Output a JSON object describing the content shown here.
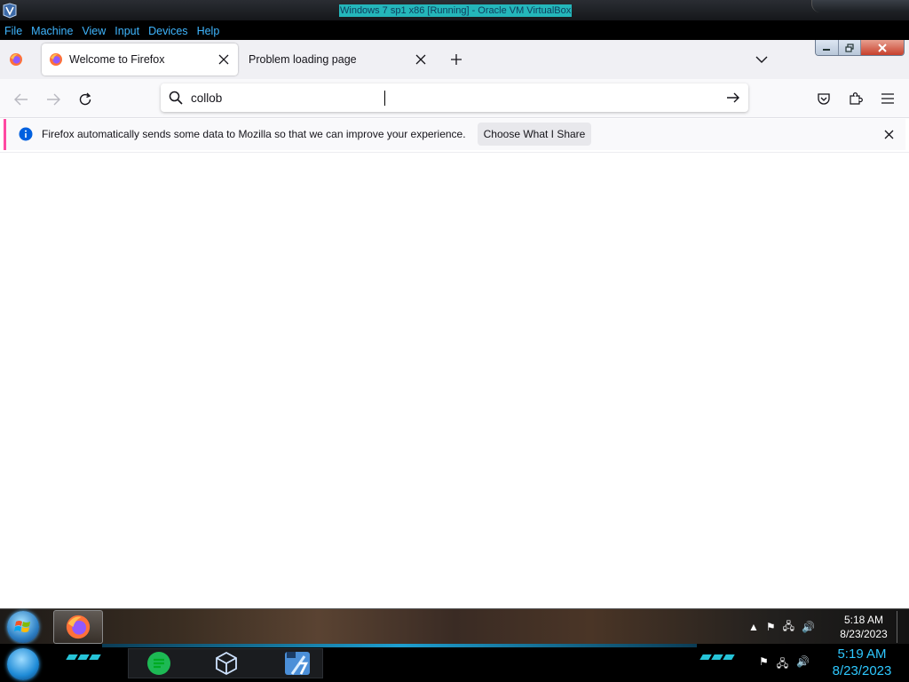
{
  "host": {
    "title": "Windows 7 sp1 x86 [Running] - Oracle VM VirtualBox",
    "menu": [
      "File",
      "Machine",
      "View",
      "Input",
      "Devices",
      "Help"
    ],
    "clock_time": "5:19 AM",
    "clock_date": "8/23/2023"
  },
  "browser": {
    "tabs": [
      {
        "label": "Welcome to Firefox"
      },
      {
        "label": "Problem loading page"
      }
    ],
    "urlbar_value": "collob",
    "notification": {
      "message": "Firefox automatically sends some data to Mozilla so that we can improve your experience.",
      "button": "Choose What I Share"
    }
  },
  "guest_taskbar": {
    "clock_time": "5:18 AM",
    "clock_date": "8/23/2023"
  },
  "colors": {
    "vbox_title_bg": "#24b6ba",
    "vbox_menu_text": "#3fb6ff",
    "notification_accent": "#ff4aa2",
    "host_clock": "#2ec8ff"
  }
}
